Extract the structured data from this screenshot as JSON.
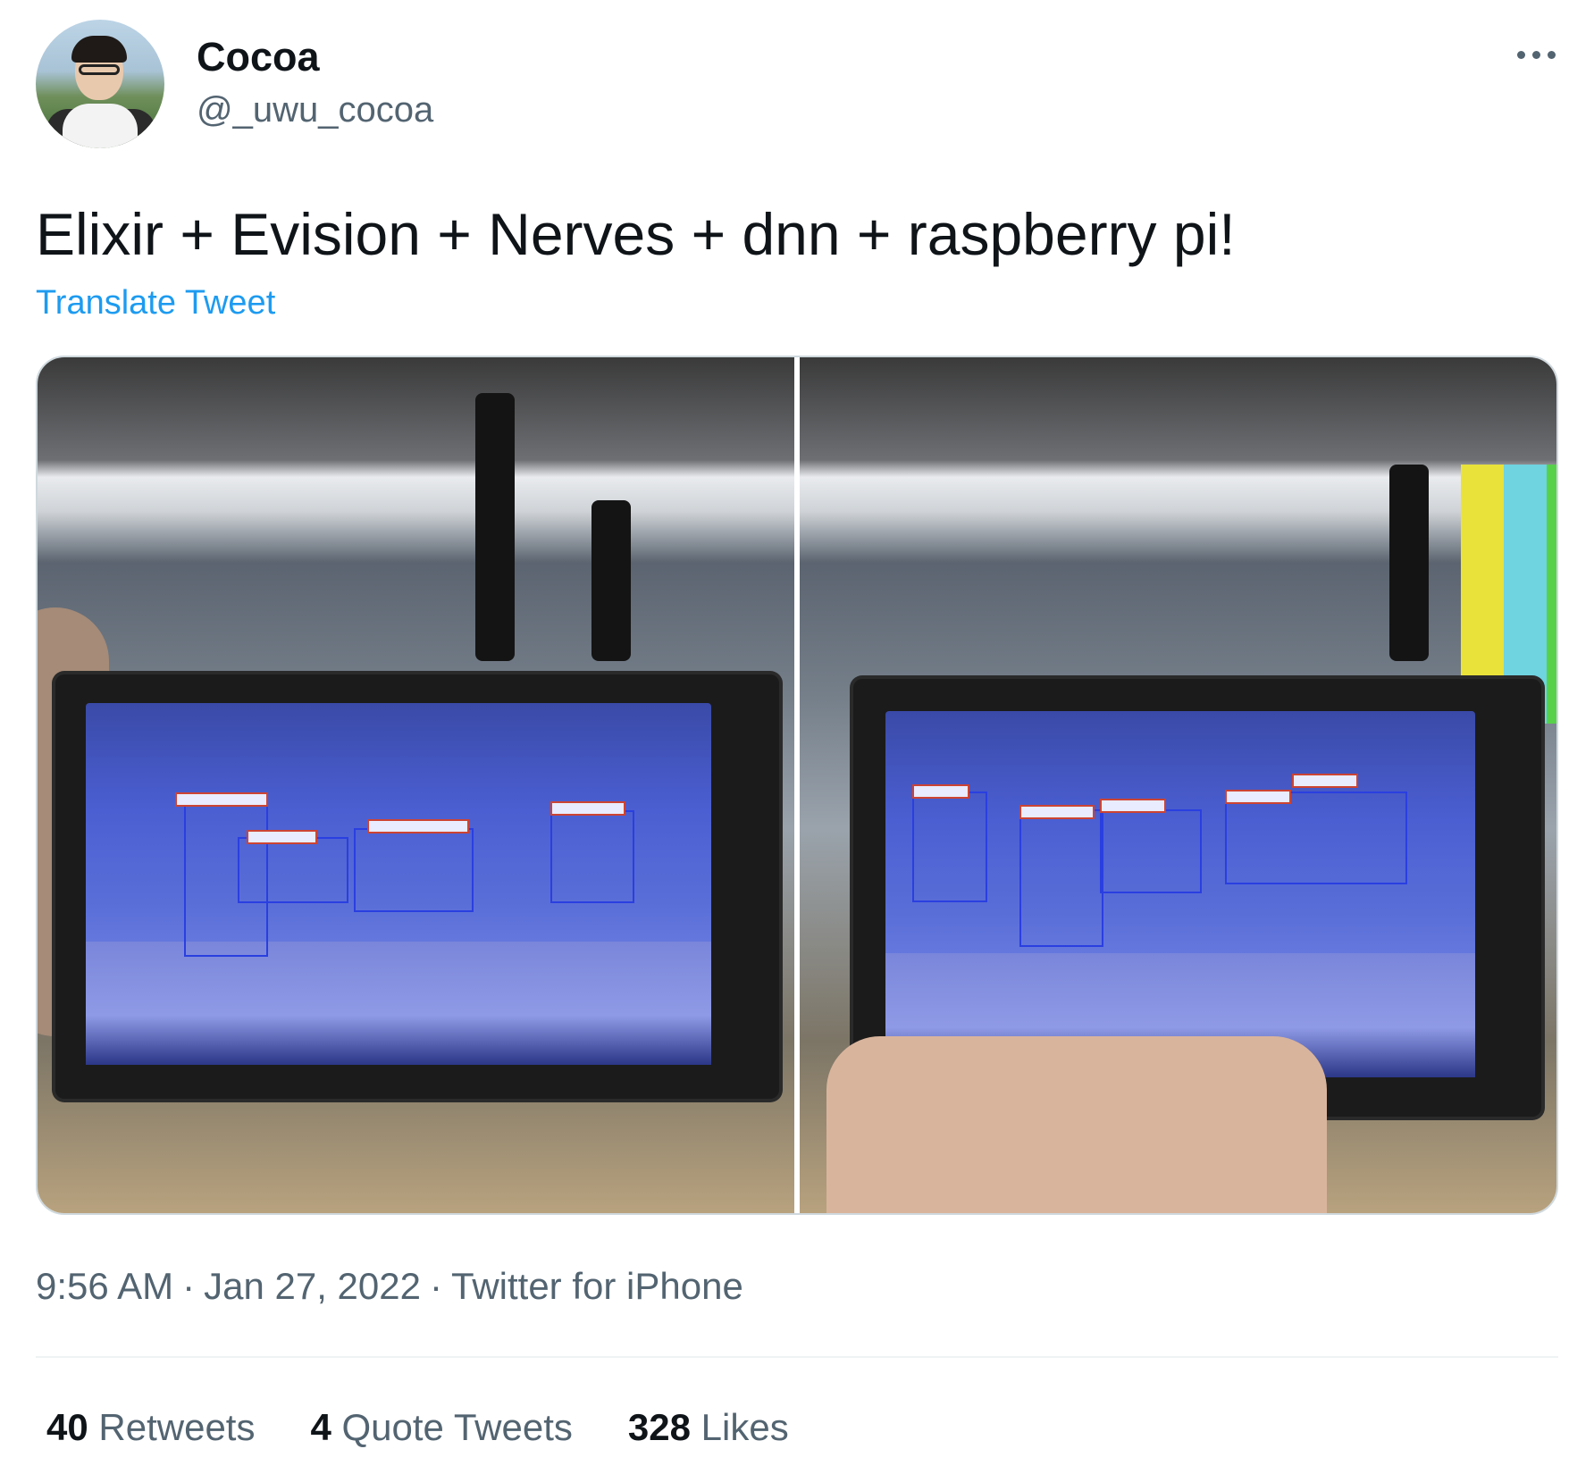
{
  "author": {
    "display_name": "Cocoa",
    "handle": "@_uwu_cocoa"
  },
  "tweet": {
    "text": "Elixir + Evision + Nerves + dnn + raspberry pi!",
    "translate_label": "Translate Tweet"
  },
  "media": {
    "count": 2
  },
  "meta": {
    "time": "9:56 AM",
    "separator": "·",
    "date": "Jan 27, 2022",
    "source": "Twitter for iPhone"
  },
  "stats": {
    "retweets_count": "40",
    "retweets_label": "Retweets",
    "quotes_count": "4",
    "quotes_label": "Quote Tweets",
    "likes_count": "328",
    "likes_label": "Likes"
  },
  "icons": {
    "more": "more-horizontal-icon"
  },
  "colors": {
    "link": "#1d9bf0",
    "secondary_text": "#536471",
    "primary_text": "#0f1419"
  }
}
